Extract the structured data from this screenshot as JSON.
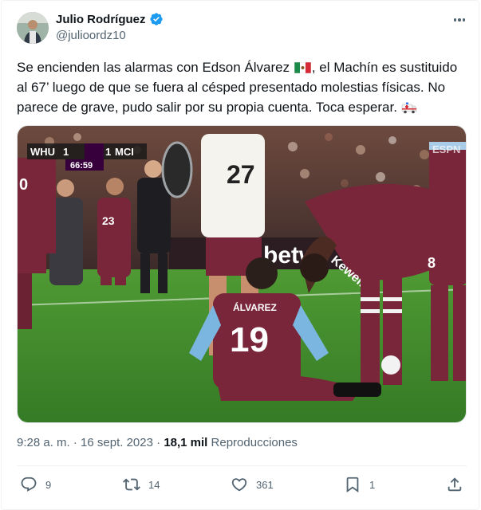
{
  "author": {
    "name": "Julio Rodríguez",
    "handle": "@julioordz10",
    "verified": true
  },
  "tweet": {
    "text_part1": "Se encienden las alarmas con Edson Álvarez",
    "text_part2": ", el Machín es sustituido al 67’ luego de que se fuera al césped presentado molestias físicas. No parece de grave, pudo salir por su propia cuenta. Toca esperar.",
    "emoji_flag": "mexico-flag",
    "emoji_end": "ambulance"
  },
  "media": {
    "scoreboard_home": "WHU",
    "scoreboard_away": "MCI",
    "score_home": "1",
    "score_away": "1",
    "clock": "66:59",
    "broadcaster": "ESPN",
    "player_name": "ÁLVAREZ",
    "player_number": "19",
    "jersey_27": "27",
    "jersey_23": "23",
    "jersey_8": "8",
    "sponsor": "betw",
    "jersey_back_name": "Kewell"
  },
  "meta": {
    "time": "9:28 a. m.",
    "separator": " · ",
    "date": "16 sept. 2023",
    "views_count": "18,1 mil",
    "views_label": " Reproducciones"
  },
  "actions": {
    "replies": "9",
    "retweets": "14",
    "likes": "361",
    "bookmarks": "1"
  },
  "colors": {
    "verified_blue": "#1d9bf0",
    "text": "#0f1419",
    "muted": "#536471",
    "claret": "#7a263a",
    "sky": "#7bb6e0",
    "pitch": "#3f8a2e"
  }
}
